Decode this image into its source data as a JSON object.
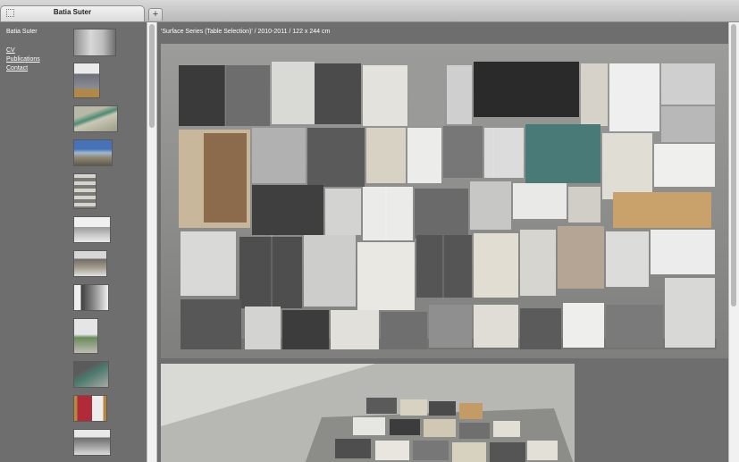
{
  "browser": {
    "tab_title": "Batia Suter",
    "newtab_label": "+"
  },
  "sidebar": {
    "artist_name": "Batia Suter",
    "nav": [
      {
        "label": "CV"
      },
      {
        "label": "Publications"
      },
      {
        "label": "Contact"
      }
    ],
    "thumbnail_count": 12
  },
  "main": {
    "caption": "'Surface Series (Table Selection)' / 2010-2011 / 122 x 244 cm"
  },
  "colors": {
    "background": "#6e6e6e",
    "text": "#ffffff"
  }
}
